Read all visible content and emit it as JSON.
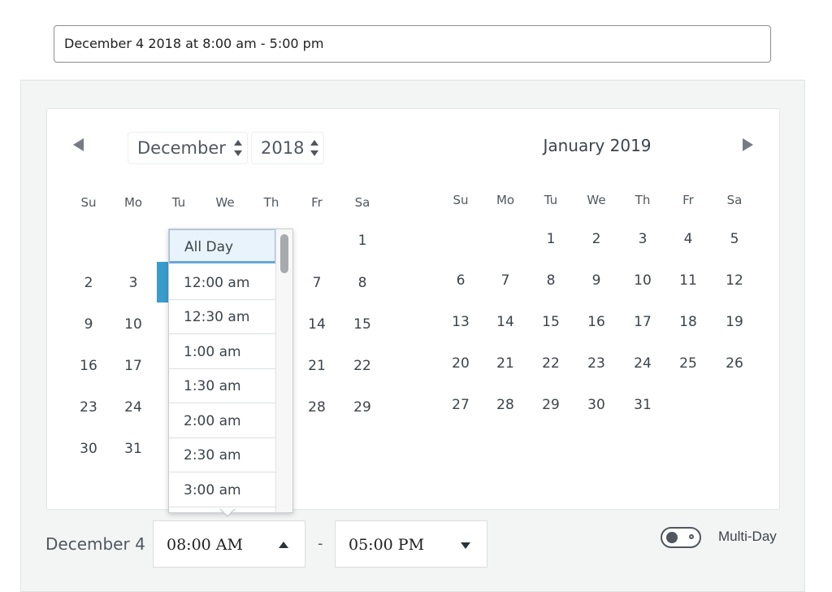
{
  "summary": {
    "value": "December 4 2018 at 8:00 am - 5:00 pm"
  },
  "left_calendar": {
    "month_select": "December",
    "year_select": "2018",
    "weekdays": [
      "Su",
      "Mo",
      "Tu",
      "We",
      "Th",
      "Fr",
      "Sa"
    ],
    "days": [
      "1",
      "2",
      "3",
      "7",
      "8",
      "9",
      "10",
      "14",
      "15",
      "16",
      "17",
      "21",
      "22",
      "23",
      "24",
      "28",
      "29",
      "30",
      "31"
    ],
    "selected_day": "4"
  },
  "right_calendar": {
    "title": "January 2019",
    "weekdays": [
      "Su",
      "Mo",
      "Tu",
      "We",
      "Th",
      "Fr",
      "Sa"
    ],
    "days": [
      "1",
      "2",
      "3",
      "4",
      "5",
      "6",
      "7",
      "8",
      "9",
      "10",
      "11",
      "12",
      "13",
      "14",
      "15",
      "16",
      "17",
      "18",
      "19",
      "20",
      "21",
      "22",
      "23",
      "24",
      "25",
      "26",
      "27",
      "28",
      "29",
      "30",
      "31"
    ]
  },
  "time_dropdown": {
    "items": [
      "All Day",
      "12:00 am",
      "12:30 am",
      "1:00 am",
      "1:30 am",
      "2:00 am",
      "2:30 am",
      "3:00 am"
    ],
    "highlighted": "All Day"
  },
  "footer": {
    "date_label": "December 4",
    "start_time": "08:00 AM",
    "separator": "-",
    "end_time": "05:00 PM",
    "multiday_label": "Multi-Day",
    "multiday_on": false
  },
  "colors": {
    "accent": "#3a9ccd",
    "panel_bg": "#f3f5f5"
  },
  "icons": {
    "prev": "triangle-left-icon",
    "next": "triangle-right-icon",
    "toggle": "toggle-off-icon"
  }
}
